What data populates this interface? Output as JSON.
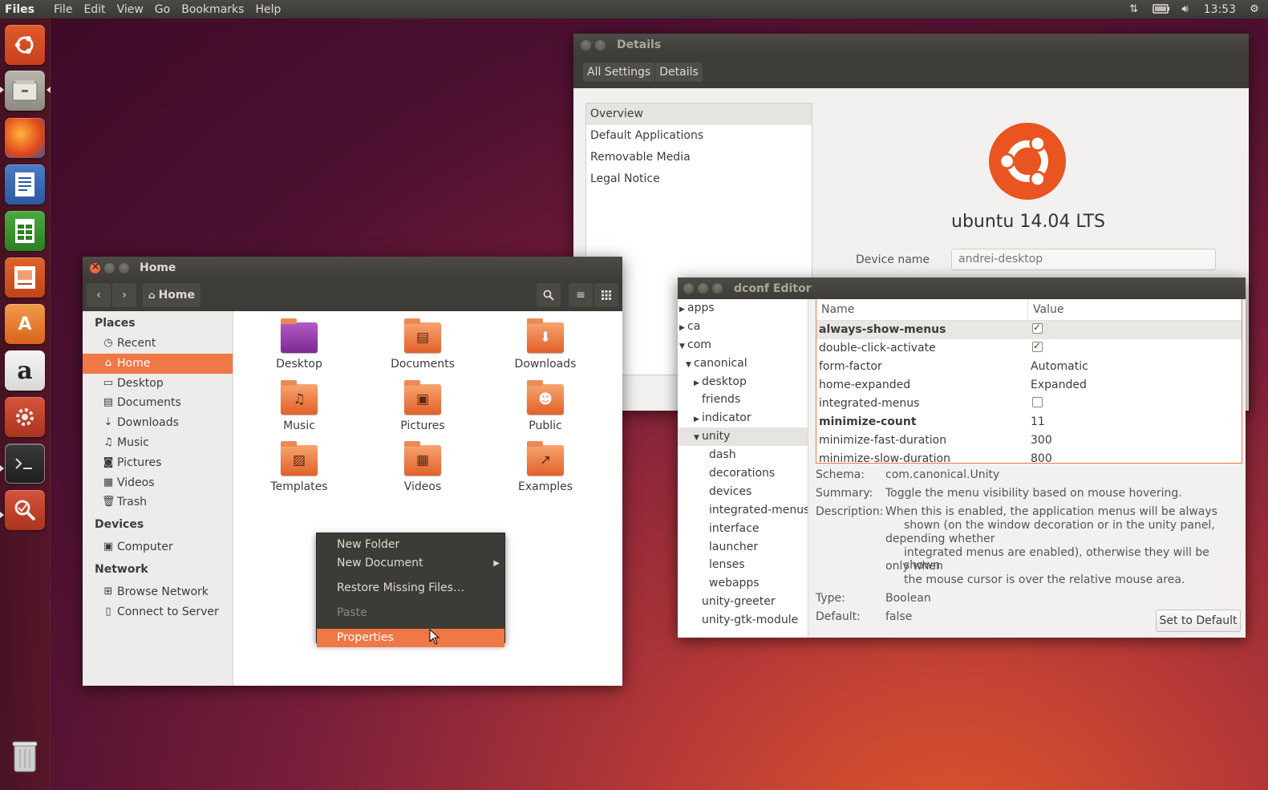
{
  "top_panel": {
    "app_name": "Files",
    "menus": [
      "File",
      "Edit",
      "View",
      "Go",
      "Bookmarks",
      "Help"
    ],
    "clock": "13:53",
    "indicators": [
      "network-icon",
      "battery-icon",
      "volume-icon",
      "gear-icon"
    ]
  },
  "launcher": {
    "items": [
      "ubuntu-dash-icon",
      "files-icon",
      "firefox-icon",
      "writer-icon",
      "calc-icon",
      "impress-icon",
      "software-center-icon",
      "amazon-icon",
      "system-settings-icon",
      "terminal-icon",
      "dconf-icon"
    ],
    "trash": "trash-icon"
  },
  "details_window": {
    "title": "Details",
    "tabs": [
      "All Settings",
      "Details"
    ],
    "sidebar": [
      "Overview",
      "Default Applications",
      "Removable Media",
      "Legal Notice"
    ],
    "os_name": "ubuntu 14.04 LTS",
    "device_name_label": "Device name",
    "device_name_value": "andrei-desktop"
  },
  "files_window": {
    "title": "Home",
    "breadcrumb": "Home",
    "sidebar": {
      "places_header": "Places",
      "places": [
        "Recent",
        "Home",
        "Desktop",
        "Documents",
        "Downloads",
        "Music",
        "Pictures",
        "Videos",
        "Trash"
      ],
      "devices_header": "Devices",
      "devices": [
        "Computer"
      ],
      "network_header": "Network",
      "network": [
        "Browse Network",
        "Connect to Server"
      ]
    },
    "folders": [
      "Desktop",
      "Documents",
      "Downloads",
      "Music",
      "Pictures",
      "Public",
      "Templates",
      "Videos",
      "Examples"
    ]
  },
  "context_menu": {
    "items": [
      "New Folder",
      "New Document",
      "Restore Missing Files…",
      "Paste",
      "Properties"
    ]
  },
  "dconf_window": {
    "title": "dconf Editor",
    "tree": [
      "apps",
      "ca",
      "com",
      "canonical",
      "desktop",
      "friends",
      "indicator",
      "unity",
      "dash",
      "decorations",
      "devices",
      "integrated-menus",
      "interface",
      "launcher",
      "lenses",
      "webapps",
      "unity-greeter",
      "unity-gtk-module"
    ],
    "columns": [
      "Name",
      "Value"
    ],
    "rows": [
      {
        "key": "always-show-menus",
        "value": "checked"
      },
      {
        "key": "double-click-activate",
        "value": "checked"
      },
      {
        "key": "form-factor",
        "value": "Automatic"
      },
      {
        "key": "home-expanded",
        "value": "Expanded"
      },
      {
        "key": "integrated-menus",
        "value": "unchecked"
      },
      {
        "key": "minimize-count",
        "value": "11"
      },
      {
        "key": "minimize-fast-duration",
        "value": "300"
      },
      {
        "key": "minimize-slow-duration",
        "value": "800"
      }
    ],
    "schema_label": "Schema:",
    "schema_value": "com.canonical.Unity",
    "summary_label": "Summary:",
    "summary_value": "Toggle the menu visibility based on mouse hovering.",
    "description_label": "Description:",
    "description_lines": [
      "When this is enabled, the application menus will be always",
      "shown (on the window decoration or in the unity panel,",
      "depending whether",
      "integrated menus are enabled), otherwise they will be shown",
      "only when",
      "the mouse cursor is over the relative mouse area."
    ],
    "type_label": "Type:",
    "type_value": "Boolean",
    "default_label": "Default:",
    "default_value": "false",
    "set_default_button": "Set to Default"
  }
}
